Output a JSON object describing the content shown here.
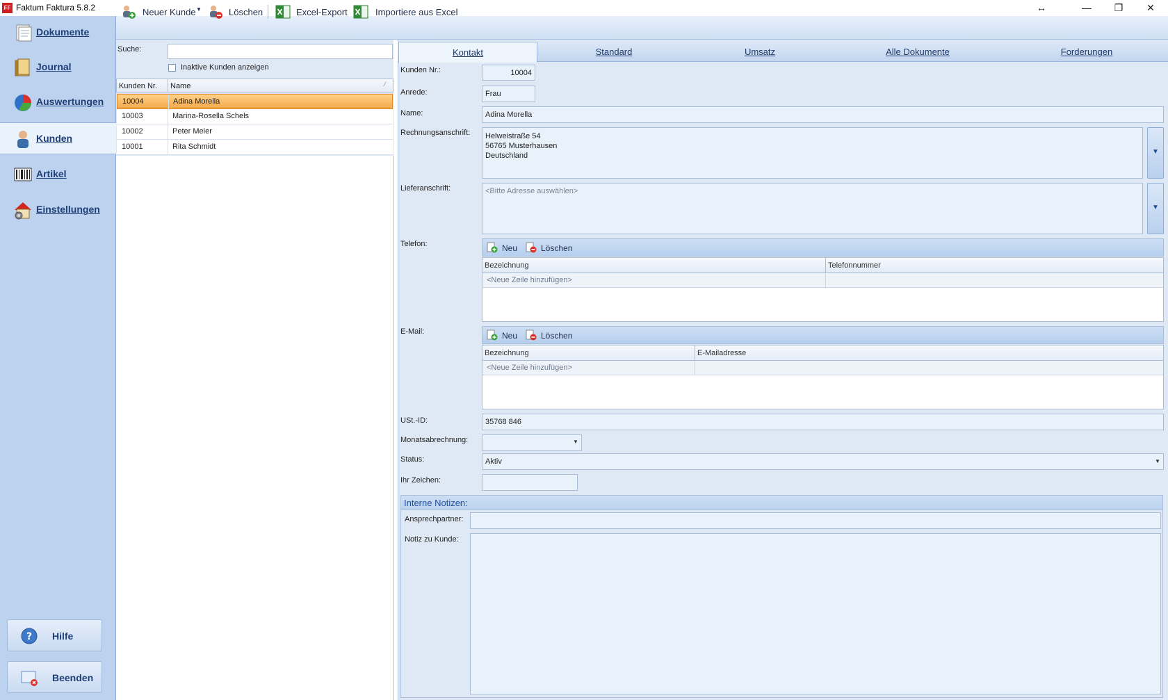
{
  "window": {
    "title": "Faktum Faktura 5.8.2",
    "logo_text": "FF",
    "controls": {
      "resize": "↔",
      "minimize": "—",
      "restore": "❐",
      "close": "✕"
    }
  },
  "sidebar": {
    "items": [
      {
        "label": "Dokumente",
        "icon": "documents-icon"
      },
      {
        "label": "Journal",
        "icon": "journal-icon"
      },
      {
        "label": "Auswertungen",
        "icon": "pie-chart-icon"
      },
      {
        "label": "Kunden",
        "icon": "customer-icon",
        "active": true
      },
      {
        "label": "Artikel",
        "icon": "barcode-icon"
      },
      {
        "label": "Einstellungen",
        "icon": "settings-house-icon"
      }
    ],
    "help_label": "Hilfe",
    "exit_label": "Beenden"
  },
  "toolbar": {
    "new_customer": "Neuer Kunde",
    "delete": "Löschen",
    "excel_export": "Excel-Export",
    "excel_import": "Importiere aus Excel"
  },
  "search": {
    "label": "Suche:",
    "value": "",
    "inactive_label": "Inaktive Kunden anzeigen",
    "inactive_checked": false
  },
  "customer_list": {
    "columns": [
      "Kunden Nr.",
      "Name"
    ],
    "rows": [
      {
        "nr": "10004",
        "name": "Adina Morella",
        "selected": true
      },
      {
        "nr": "10003",
        "name": "Marina-Rosella Schels"
      },
      {
        "nr": "10002",
        "name": "Peter Meier"
      },
      {
        "nr": "10001",
        "name": "Rita Schmidt"
      }
    ]
  },
  "tabs": [
    "Kontakt",
    "Standard",
    "Umsatz",
    "Alle Dokumente",
    "Forderungen"
  ],
  "form": {
    "kunden_nr_label": "Kunden Nr.:",
    "kunden_nr": "10004",
    "anrede_label": "Anrede:",
    "anrede": "Frau",
    "name_label": "Name:",
    "name": "Adina Morella",
    "rechnung_label": "Rechnungsanschrift:",
    "rechnung_line1": "Helweistraße 54",
    "rechnung_line2": "56765 Musterhausen",
    "rechnung_line3": "Deutschland",
    "liefer_label": "Lieferanschrift:",
    "liefer_placeholder": "<Bitte Adresse auswählen>",
    "telefon_label": "Telefon:",
    "email_label": "E-Mail:",
    "neu": "Neu",
    "loeschen": "Löschen",
    "col_bezeichnung": "Bezeichnung",
    "col_telefon": "Telefonnummer",
    "col_email": "E-Mailadresse",
    "new_row": "<Neue Zeile hinzufügen>",
    "ust_label": "USt.-ID:",
    "ust": "35768 846",
    "monat_label": "Monatsabrechnung:",
    "monat": "",
    "status_label": "Status:",
    "status": "Aktiv",
    "zeichen_label": "Ihr Zeichen:",
    "zeichen": "",
    "notes_title": "Interne Notizen:",
    "ansprech_label": "Ansprechpartner:",
    "ansprech": "",
    "notiz_label": "Notiz zu Kunde:",
    "notiz": ""
  }
}
